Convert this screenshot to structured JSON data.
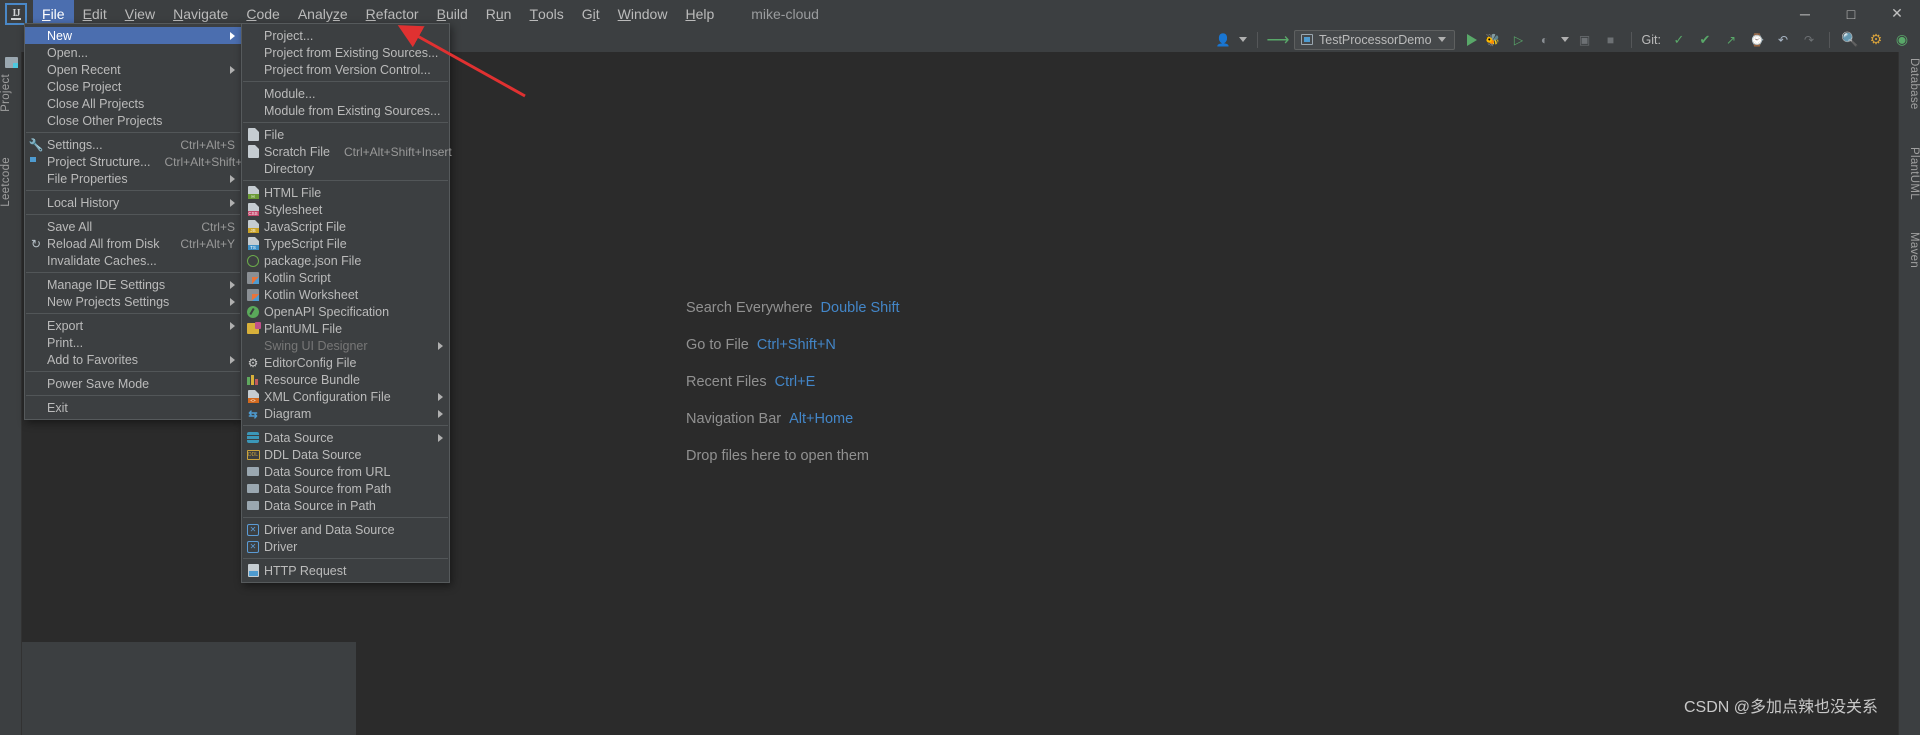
{
  "window": {
    "user_label": "mike-cloud",
    "minimize": "─",
    "maximize": "□",
    "close": "✕"
  },
  "menubar": {
    "items": [
      {
        "label": "File",
        "mnemonic": "F"
      },
      {
        "label": "Edit",
        "mnemonic": "E"
      },
      {
        "label": "View",
        "mnemonic": "V"
      },
      {
        "label": "Navigate",
        "mnemonic": "N"
      },
      {
        "label": "Code",
        "mnemonic": "C"
      },
      {
        "label": "Analyze",
        "mnemonic": "z"
      },
      {
        "label": "Refactor",
        "mnemonic": "R"
      },
      {
        "label": "Build",
        "mnemonic": "B"
      },
      {
        "label": "Run",
        "mnemonic": "u"
      },
      {
        "label": "Tools",
        "mnemonic": "T"
      },
      {
        "label": "Git",
        "mnemonic": "i"
      },
      {
        "label": "Window",
        "mnemonic": "W"
      },
      {
        "label": "Help",
        "mnemonic": "H"
      }
    ]
  },
  "toolbar": {
    "run_configuration": "TestProcessorDemo",
    "git_label": "Git:",
    "icons": [
      "user-avatar-icon",
      "chevron-down-icon",
      "hammer-build-icon",
      "run-icon",
      "debug-icon",
      "run-coverage-icon",
      "profiler-icon",
      "stop-icon",
      "git-update-icon",
      "git-commit-icon",
      "git-push-icon",
      "history-icon",
      "undo-icon",
      "redo-icon",
      "search-icon",
      "settings-icon",
      "plugin-icon"
    ]
  },
  "left_tool_strip": {
    "labels": [
      "Project",
      "Leetcode"
    ]
  },
  "right_tool_strip": {
    "labels": [
      "Database",
      "PlantUML",
      "Maven"
    ]
  },
  "editor_hints": [
    {
      "label": "Search Everywhere",
      "shortcut": "Double Shift"
    },
    {
      "label": "Go to File",
      "shortcut": "Ctrl+Shift+N"
    },
    {
      "label": "Recent Files",
      "shortcut": "Ctrl+E"
    },
    {
      "label": "Navigation Bar",
      "shortcut": "Alt+Home"
    },
    {
      "label": "Drop files here to open them",
      "shortcut": ""
    }
  ],
  "file_menu": {
    "items": [
      {
        "label": "New",
        "icon": "",
        "accel": "",
        "submenu": true,
        "selected": true
      },
      {
        "label": "Open...",
        "icon": "folder-icon",
        "accel": "",
        "submenu": false
      },
      {
        "label": "Open Recent",
        "icon": "",
        "accel": "",
        "submenu": true
      },
      {
        "label": "Close Project",
        "icon": "",
        "accel": "",
        "submenu": false
      },
      {
        "label": "Close All Projects",
        "icon": "",
        "accel": "",
        "submenu": false
      },
      {
        "label": "Close Other Projects",
        "icon": "",
        "accel": "",
        "submenu": false
      },
      {
        "separator": true
      },
      {
        "label": "Settings...",
        "icon": "wrench-icon",
        "accel": "Ctrl+Alt+S",
        "submenu": false
      },
      {
        "label": "Project Structure...",
        "icon": "project-structure-icon",
        "accel": "Ctrl+Alt+Shift+S",
        "submenu": false
      },
      {
        "label": "File Properties",
        "icon": "",
        "accel": "",
        "submenu": true
      },
      {
        "separator": true
      },
      {
        "label": "Local History",
        "icon": "",
        "accel": "",
        "submenu": true
      },
      {
        "separator": true
      },
      {
        "label": "Save All",
        "icon": "save-icon",
        "accel": "Ctrl+S",
        "submenu": false
      },
      {
        "label": "Reload All from Disk",
        "icon": "reload-icon",
        "accel": "Ctrl+Alt+Y",
        "submenu": false
      },
      {
        "label": "Invalidate Caches...",
        "icon": "",
        "accel": "",
        "submenu": false
      },
      {
        "separator": true
      },
      {
        "label": "Manage IDE Settings",
        "icon": "",
        "accel": "",
        "submenu": true
      },
      {
        "label": "New Projects Settings",
        "icon": "",
        "accel": "",
        "submenu": true
      },
      {
        "separator": true
      },
      {
        "label": "Export",
        "icon": "",
        "accel": "",
        "submenu": true
      },
      {
        "label": "Print...",
        "icon": "print-icon",
        "accel": "",
        "submenu": false
      },
      {
        "label": "Add to Favorites",
        "icon": "",
        "accel": "",
        "submenu": true
      },
      {
        "separator": true
      },
      {
        "label": "Power Save Mode",
        "icon": "",
        "accel": "",
        "submenu": false
      },
      {
        "separator": true
      },
      {
        "label": "Exit",
        "icon": "",
        "accel": "",
        "submenu": false
      }
    ]
  },
  "new_submenu": {
    "items": [
      {
        "label": "Project...",
        "icon": "",
        "accel": "",
        "submenu": false
      },
      {
        "label": "Project from Existing Sources...",
        "icon": "",
        "accel": "",
        "submenu": false
      },
      {
        "label": "Project from Version Control...",
        "icon": "",
        "accel": "",
        "submenu": false
      },
      {
        "separator": true
      },
      {
        "label": "Module...",
        "icon": "",
        "accel": "",
        "submenu": false
      },
      {
        "label": "Module from Existing Sources...",
        "icon": "",
        "accel": "",
        "submenu": false
      },
      {
        "separator": true
      },
      {
        "label": "File",
        "icon": "file-icon",
        "accel": "",
        "submenu": false
      },
      {
        "label": "Scratch File",
        "icon": "scratch-file-icon",
        "accel": "Ctrl+Alt+Shift+Insert",
        "submenu": false
      },
      {
        "label": "Directory",
        "icon": "directory-icon",
        "accel": "",
        "submenu": false
      },
      {
        "separator": true
      },
      {
        "label": "HTML File",
        "icon": "html-file-icon",
        "accel": "",
        "submenu": false
      },
      {
        "label": "Stylesheet",
        "icon": "css-file-icon",
        "accel": "",
        "submenu": false
      },
      {
        "label": "JavaScript File",
        "icon": "js-file-icon",
        "accel": "",
        "submenu": false
      },
      {
        "label": "TypeScript File",
        "icon": "ts-file-icon",
        "accel": "",
        "submenu": false
      },
      {
        "label": "package.json File",
        "icon": "nodejs-icon",
        "accel": "",
        "submenu": false
      },
      {
        "label": "Kotlin Script",
        "icon": "kotlin-script-icon",
        "accel": "",
        "submenu": false
      },
      {
        "label": "Kotlin Worksheet",
        "icon": "kotlin-worksheet-icon",
        "accel": "",
        "submenu": false
      },
      {
        "label": "OpenAPI Specification",
        "icon": "openapi-icon",
        "accel": "",
        "submenu": false
      },
      {
        "label": "PlantUML File",
        "icon": "plantuml-icon",
        "accel": "",
        "submenu": false
      },
      {
        "label": "Swing UI Designer",
        "icon": "",
        "accel": "",
        "submenu": true,
        "disabled": true
      },
      {
        "label": "EditorConfig File",
        "icon": "gear-icon",
        "accel": "",
        "submenu": false
      },
      {
        "label": "Resource Bundle",
        "icon": "resource-bundle-icon",
        "accel": "",
        "submenu": false
      },
      {
        "label": "XML Configuration File",
        "icon": "xml-file-icon",
        "accel": "",
        "submenu": true
      },
      {
        "label": "Diagram",
        "icon": "diagram-icon",
        "accel": "",
        "submenu": true
      },
      {
        "separator": true
      },
      {
        "label": "Data Source",
        "icon": "data-source-icon",
        "accel": "",
        "submenu": true
      },
      {
        "label": "DDL Data Source",
        "icon": "ddl-data-source-icon",
        "accel": "",
        "submenu": false
      },
      {
        "label": "Data Source from URL",
        "icon": "data-source-url-icon",
        "accel": "",
        "submenu": false
      },
      {
        "label": "Data Source from Path",
        "icon": "data-source-path-icon",
        "accel": "",
        "submenu": false
      },
      {
        "label": "Data Source in Path",
        "icon": "data-source-in-path-icon",
        "accel": "",
        "submenu": false
      },
      {
        "separator": true
      },
      {
        "label": "Driver and Data Source",
        "icon": "driver-data-source-icon",
        "accel": "",
        "submenu": false
      },
      {
        "label": "Driver",
        "icon": "driver-icon",
        "accel": "",
        "submenu": false
      },
      {
        "separator": true
      },
      {
        "label": "HTTP Request",
        "icon": "http-request-icon",
        "accel": "",
        "submenu": false
      }
    ]
  },
  "watermark": "CSDN @多加点辣也没关系",
  "colors": {
    "menu_bg": "#3c3f41",
    "editor_bg": "#2b2b2b",
    "selection": "#4b6eaf",
    "accent_link": "#4386c8",
    "annotation_arrow": "#e03131",
    "run_green": "#59a869"
  }
}
